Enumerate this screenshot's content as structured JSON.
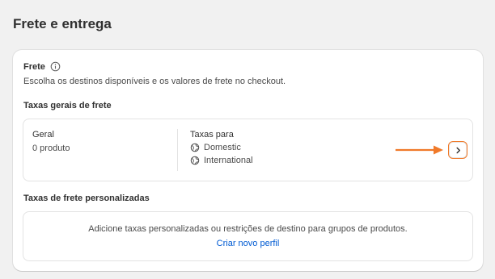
{
  "page": {
    "title": "Frete e entrega"
  },
  "shipping": {
    "title": "Frete",
    "description": "Escolha os destinos disponíveis e os valores de frete no checkout.",
    "general_rates": {
      "title": "Taxas gerais de frete",
      "profile_name": "Geral",
      "product_count": "0 produto",
      "rates_for_label": "Taxas para",
      "zones": [
        {
          "name": "Domestic",
          "icon": "globe-icon"
        },
        {
          "name": "International",
          "icon": "globe-icon"
        }
      ]
    },
    "custom_rates": {
      "title": "Taxas de frete personalizadas",
      "description": "Adicione taxas personalizadas ou restrições de destino para grupos de produtos.",
      "link": "Criar novo perfil"
    }
  },
  "colors": {
    "accent": "#f07a2a",
    "link": "#005bd3"
  },
  "icons": {
    "info": "info-icon",
    "chevron": "chevron-right-icon",
    "annotation": "arrow-right-icon"
  }
}
